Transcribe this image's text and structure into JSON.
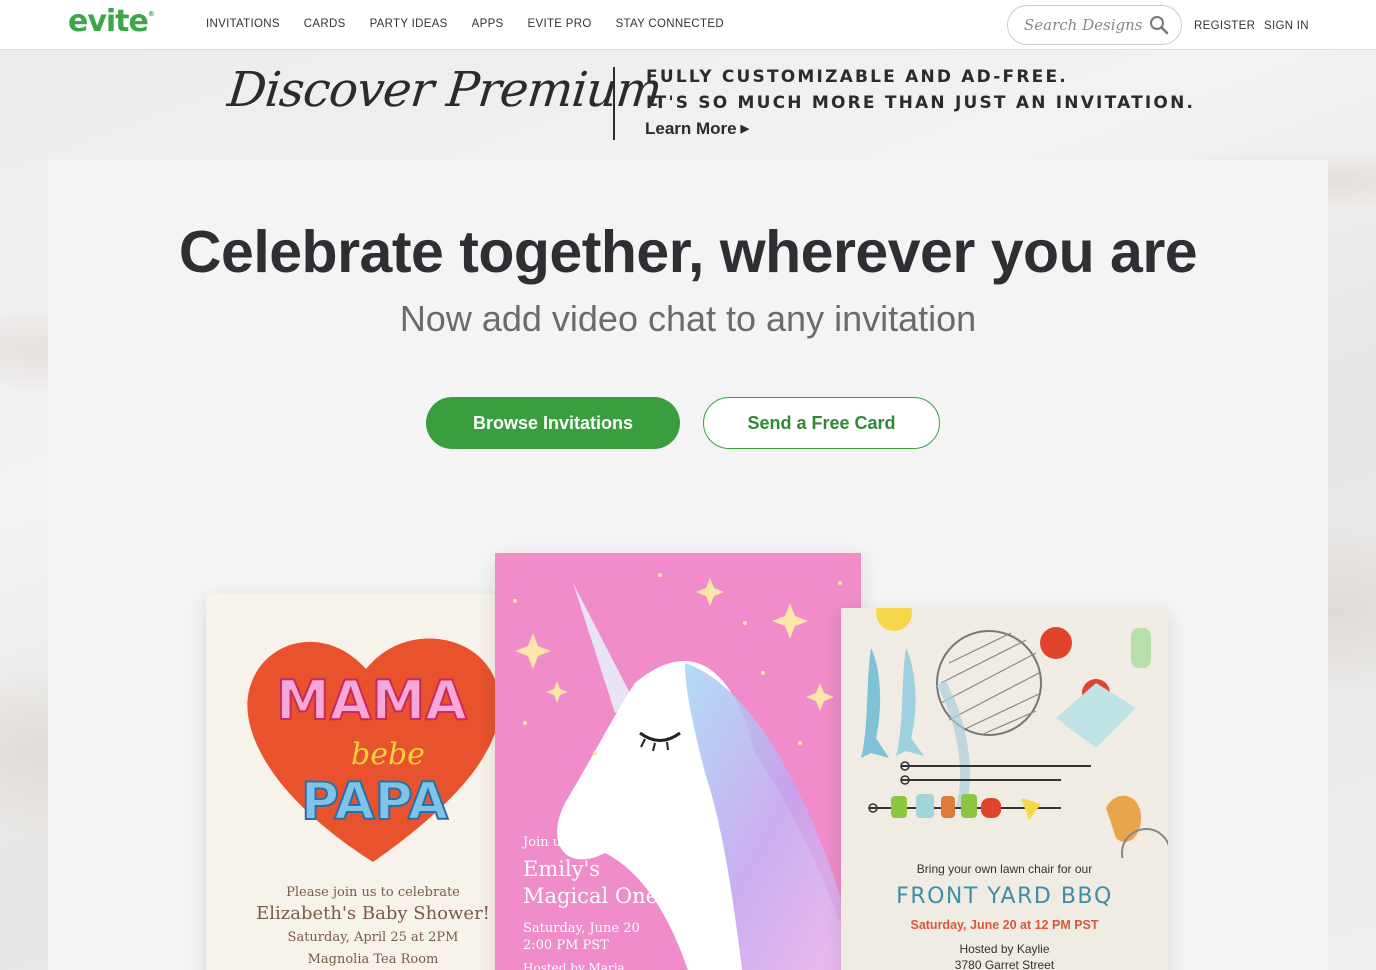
{
  "header": {
    "logo": "evite",
    "nav": [
      "INVITATIONS",
      "CARDS",
      "PARTY IDEAS",
      "APPS",
      "EVITE PRO",
      "STAY CONNECTED"
    ],
    "search_placeholder": "Search Designs",
    "register": "REGISTER",
    "sign_in": "SIGN IN"
  },
  "premium": {
    "title": "Discover Premium",
    "line1": "FULLY CUSTOMIZABLE AND AD-FREE.",
    "line2": "IT'S SO MUCH MORE THAN JUST AN INVITATION.",
    "learn_more": "Learn More"
  },
  "hero": {
    "title": "Celebrate together, wherever you are",
    "subtitle": "Now add video chat to any invitation",
    "browse_button": "Browse Invitations",
    "send_card_button": "Send a Free Card"
  },
  "cards": {
    "mama": {
      "heart_text_1": "MAMA",
      "heart_text_2": "bebe",
      "heart_text_3": "PAPA",
      "line1": "Please join us to celebrate",
      "line2": "Elizabeth's Baby Shower!",
      "line3": "Saturday, April 25 at 2PM",
      "line4": "Magnolia Tea Room"
    },
    "unicorn": {
      "line1": "Join us for",
      "line2a": "Emily's",
      "line2b": "Magical One",
      "line3a": "Saturday, June 20",
      "line3b": "2:00 PM PST",
      "line4": "Hosted by Maria"
    },
    "bbq": {
      "line1": "Bring your own lawn chair for our",
      "line2": "FRONT YARD BBQ",
      "line3": "Saturday, June 20 at 12 PM PST",
      "line4": "Hosted by Kaylie",
      "line5": "3780 Garret Street"
    }
  },
  "colors": {
    "brand_green": "#3aa84a",
    "button_green": "#3a9e3f",
    "unicorn_pink": "#ef8cc9",
    "heart_red": "#e8532e"
  }
}
